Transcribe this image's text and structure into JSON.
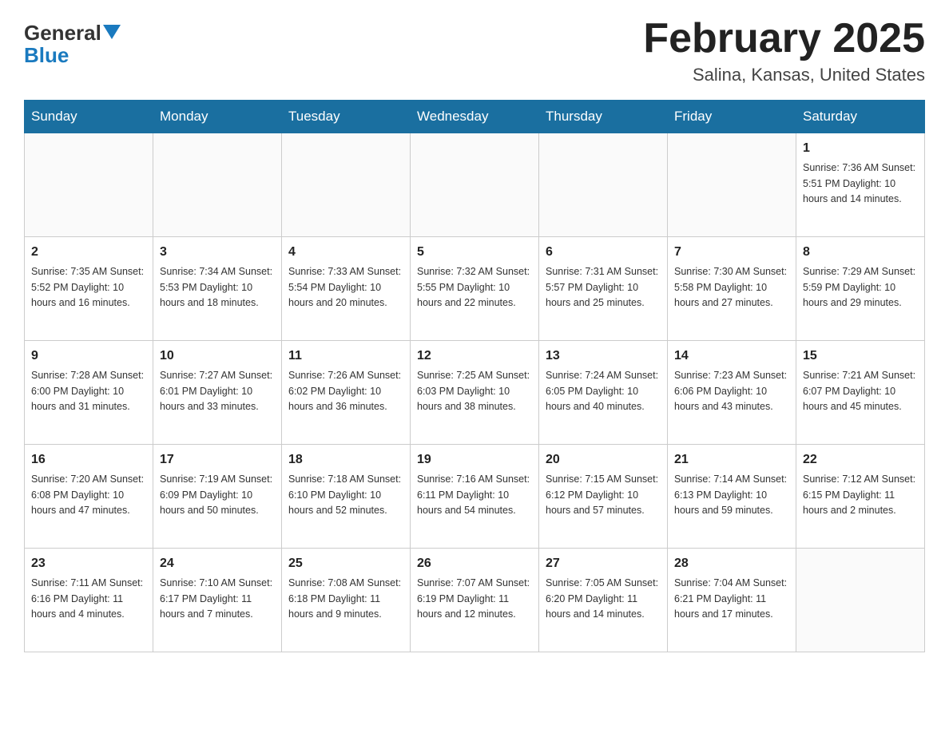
{
  "header": {
    "title": "February 2025",
    "subtitle": "Salina, Kansas, United States",
    "logo_general": "General",
    "logo_blue": "Blue"
  },
  "weekdays": [
    "Sunday",
    "Monday",
    "Tuesday",
    "Wednesday",
    "Thursday",
    "Friday",
    "Saturday"
  ],
  "weeks": [
    [
      {
        "day": "",
        "info": ""
      },
      {
        "day": "",
        "info": ""
      },
      {
        "day": "",
        "info": ""
      },
      {
        "day": "",
        "info": ""
      },
      {
        "day": "",
        "info": ""
      },
      {
        "day": "",
        "info": ""
      },
      {
        "day": "1",
        "info": "Sunrise: 7:36 AM\nSunset: 5:51 PM\nDaylight: 10 hours\nand 14 minutes."
      }
    ],
    [
      {
        "day": "2",
        "info": "Sunrise: 7:35 AM\nSunset: 5:52 PM\nDaylight: 10 hours\nand 16 minutes."
      },
      {
        "day": "3",
        "info": "Sunrise: 7:34 AM\nSunset: 5:53 PM\nDaylight: 10 hours\nand 18 minutes."
      },
      {
        "day": "4",
        "info": "Sunrise: 7:33 AM\nSunset: 5:54 PM\nDaylight: 10 hours\nand 20 minutes."
      },
      {
        "day": "5",
        "info": "Sunrise: 7:32 AM\nSunset: 5:55 PM\nDaylight: 10 hours\nand 22 minutes."
      },
      {
        "day": "6",
        "info": "Sunrise: 7:31 AM\nSunset: 5:57 PM\nDaylight: 10 hours\nand 25 minutes."
      },
      {
        "day": "7",
        "info": "Sunrise: 7:30 AM\nSunset: 5:58 PM\nDaylight: 10 hours\nand 27 minutes."
      },
      {
        "day": "8",
        "info": "Sunrise: 7:29 AM\nSunset: 5:59 PM\nDaylight: 10 hours\nand 29 minutes."
      }
    ],
    [
      {
        "day": "9",
        "info": "Sunrise: 7:28 AM\nSunset: 6:00 PM\nDaylight: 10 hours\nand 31 minutes."
      },
      {
        "day": "10",
        "info": "Sunrise: 7:27 AM\nSunset: 6:01 PM\nDaylight: 10 hours\nand 33 minutes."
      },
      {
        "day": "11",
        "info": "Sunrise: 7:26 AM\nSunset: 6:02 PM\nDaylight: 10 hours\nand 36 minutes."
      },
      {
        "day": "12",
        "info": "Sunrise: 7:25 AM\nSunset: 6:03 PM\nDaylight: 10 hours\nand 38 minutes."
      },
      {
        "day": "13",
        "info": "Sunrise: 7:24 AM\nSunset: 6:05 PM\nDaylight: 10 hours\nand 40 minutes."
      },
      {
        "day": "14",
        "info": "Sunrise: 7:23 AM\nSunset: 6:06 PM\nDaylight: 10 hours\nand 43 minutes."
      },
      {
        "day": "15",
        "info": "Sunrise: 7:21 AM\nSunset: 6:07 PM\nDaylight: 10 hours\nand 45 minutes."
      }
    ],
    [
      {
        "day": "16",
        "info": "Sunrise: 7:20 AM\nSunset: 6:08 PM\nDaylight: 10 hours\nand 47 minutes."
      },
      {
        "day": "17",
        "info": "Sunrise: 7:19 AM\nSunset: 6:09 PM\nDaylight: 10 hours\nand 50 minutes."
      },
      {
        "day": "18",
        "info": "Sunrise: 7:18 AM\nSunset: 6:10 PM\nDaylight: 10 hours\nand 52 minutes."
      },
      {
        "day": "19",
        "info": "Sunrise: 7:16 AM\nSunset: 6:11 PM\nDaylight: 10 hours\nand 54 minutes."
      },
      {
        "day": "20",
        "info": "Sunrise: 7:15 AM\nSunset: 6:12 PM\nDaylight: 10 hours\nand 57 minutes."
      },
      {
        "day": "21",
        "info": "Sunrise: 7:14 AM\nSunset: 6:13 PM\nDaylight: 10 hours\nand 59 minutes."
      },
      {
        "day": "22",
        "info": "Sunrise: 7:12 AM\nSunset: 6:15 PM\nDaylight: 11 hours\nand 2 minutes."
      }
    ],
    [
      {
        "day": "23",
        "info": "Sunrise: 7:11 AM\nSunset: 6:16 PM\nDaylight: 11 hours\nand 4 minutes."
      },
      {
        "day": "24",
        "info": "Sunrise: 7:10 AM\nSunset: 6:17 PM\nDaylight: 11 hours\nand 7 minutes."
      },
      {
        "day": "25",
        "info": "Sunrise: 7:08 AM\nSunset: 6:18 PM\nDaylight: 11 hours\nand 9 minutes."
      },
      {
        "day": "26",
        "info": "Sunrise: 7:07 AM\nSunset: 6:19 PM\nDaylight: 11 hours\nand 12 minutes."
      },
      {
        "day": "27",
        "info": "Sunrise: 7:05 AM\nSunset: 6:20 PM\nDaylight: 11 hours\nand 14 minutes."
      },
      {
        "day": "28",
        "info": "Sunrise: 7:04 AM\nSunset: 6:21 PM\nDaylight: 11 hours\nand 17 minutes."
      },
      {
        "day": "",
        "info": ""
      }
    ]
  ]
}
